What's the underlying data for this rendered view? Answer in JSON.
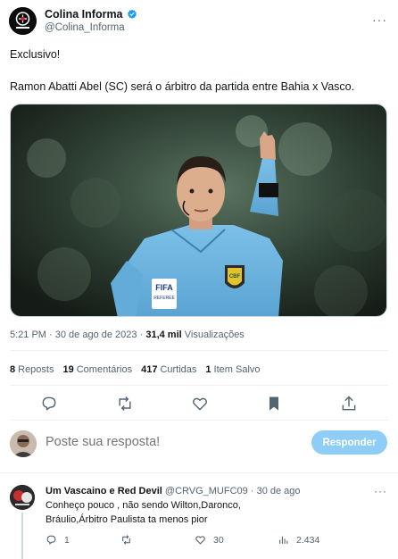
{
  "tweet": {
    "author_name": "Colina Informa",
    "author_handle": "@Colina_Informa",
    "line1": "Exclusivo!",
    "line2": "Ramon Abatti Abel (SC) será o árbitro da partida entre Bahia x Vasco.",
    "time": "5:21 PM",
    "date": "30 de ago de 2023",
    "views_count": "31,4 mil",
    "views_label": "Visualizações",
    "image_badges": {
      "fifa": "FIFA",
      "fifa_sub": "REFEREE",
      "cbf": "CBF"
    }
  },
  "stats": {
    "reposts_count": "8",
    "reposts_label": "Reposts",
    "comments_count": "19",
    "comments_label": "Comentários",
    "likes_count": "417",
    "likes_label": "Curtidas",
    "saves_count": "1",
    "saves_label": "Item Salvo"
  },
  "composer": {
    "placeholder": "Poste sua resposta!",
    "button_label": "Responder"
  },
  "reply": {
    "name": "Um Vascaino e Red Devil",
    "handle": "@CRVG_MUFC09",
    "date": "30 de ago",
    "text_line1": "Conheço pouco , não sendo Wilton,Daronco,",
    "text_line2": "Bráulio,Árbitro Paulista ta menos pior",
    "replies": "1",
    "reposts": "",
    "likes": "30",
    "views": "2.434"
  },
  "colors": {
    "accent": "#1d9bf0",
    "reply_button": "#8ecdf8",
    "muted_text": "#536471",
    "referee_shirt": "#6fb4df"
  }
}
